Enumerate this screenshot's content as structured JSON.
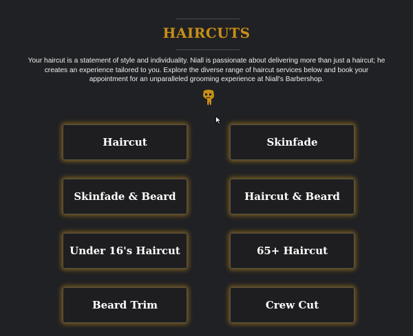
{
  "page": {
    "title": "HAIRCUTS",
    "intro": "Your haircut is a statement of style and individuality. Niall is passionate about delivering more than just a haircut; he creates an experience tailored to you. Explore the diverse range of haircut services below and book your appointment for an unparalleled grooming experience at Niall's Barbershop."
  },
  "icons": {
    "logo": "barber-logo-icon",
    "cursor": "mouse-pointer-icon"
  },
  "services": [
    {
      "label": "Haircut"
    },
    {
      "label": "Skinfade"
    },
    {
      "label": "Skinfade & Beard"
    },
    {
      "label": "Haircut & Beard"
    },
    {
      "label": "Under 16's Haircut"
    },
    {
      "label": "65+ Haircut"
    },
    {
      "label": "Beard Trim"
    },
    {
      "label": "Crew Cut"
    }
  ],
  "colors": {
    "background": "#202124",
    "accent": "#c88f17",
    "button_bg": "#1e1e20",
    "text": "#ffffff"
  }
}
